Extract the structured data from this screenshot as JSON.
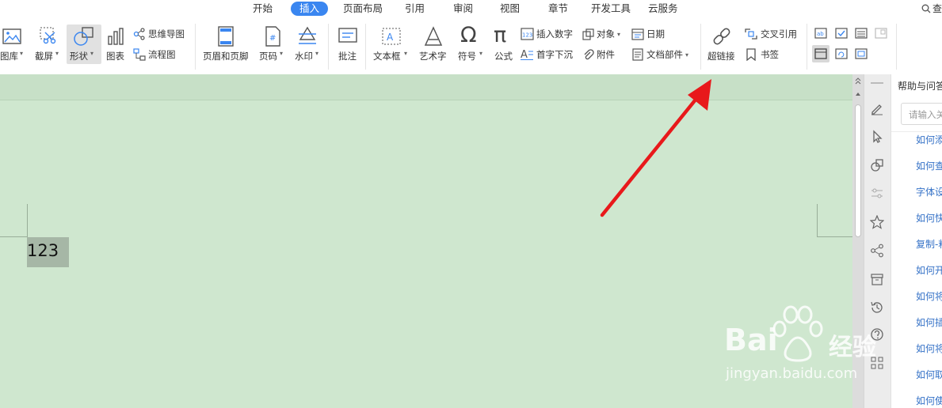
{
  "menu": {
    "tabs": [
      "开始",
      "插入",
      "页面布局",
      "引用",
      "审阅",
      "视图",
      "章节",
      "开发工具",
      "云服务"
    ],
    "active_tab": "插入",
    "search_glyph": "查"
  },
  "ribbon": {
    "picture_lib": "图库",
    "screenshot": "截屏",
    "shapes": "形状",
    "chart": "图表",
    "mindmap": "思维导图",
    "flowchart": "流程图",
    "header_footer": "页眉和页脚",
    "page_number": "页码",
    "watermark": "水印",
    "comment": "批注",
    "textbox": "文本框",
    "wordart": "艺术字",
    "symbol": "符号",
    "formula": "公式",
    "insert_number": "插入数字",
    "object": "对象",
    "date": "日期",
    "drop_cap": "首字下沉",
    "attachment": "附件",
    "doc_parts": "文档部件",
    "hyperlink": "超链接",
    "cross_reference": "交叉引用",
    "bookmark": "书签"
  },
  "document": {
    "text": "123",
    "highlight_color": "#a6b7a6",
    "background": "#cfe7cf"
  },
  "help_pane": {
    "title": "帮助与问答",
    "search_placeholder": "请输入关",
    "links": [
      "如何添",
      "如何查",
      "字体设",
      "如何快",
      "复制-粘",
      "如何开",
      "如何将",
      "如何插",
      "如何将",
      "如何取",
      "如何使"
    ]
  },
  "annotation": {
    "arrow_color": "#e8191b"
  },
  "watermark": {
    "brand": "Bai",
    "brand_tail": "经验",
    "url": "jingyan.baidu.com"
  }
}
